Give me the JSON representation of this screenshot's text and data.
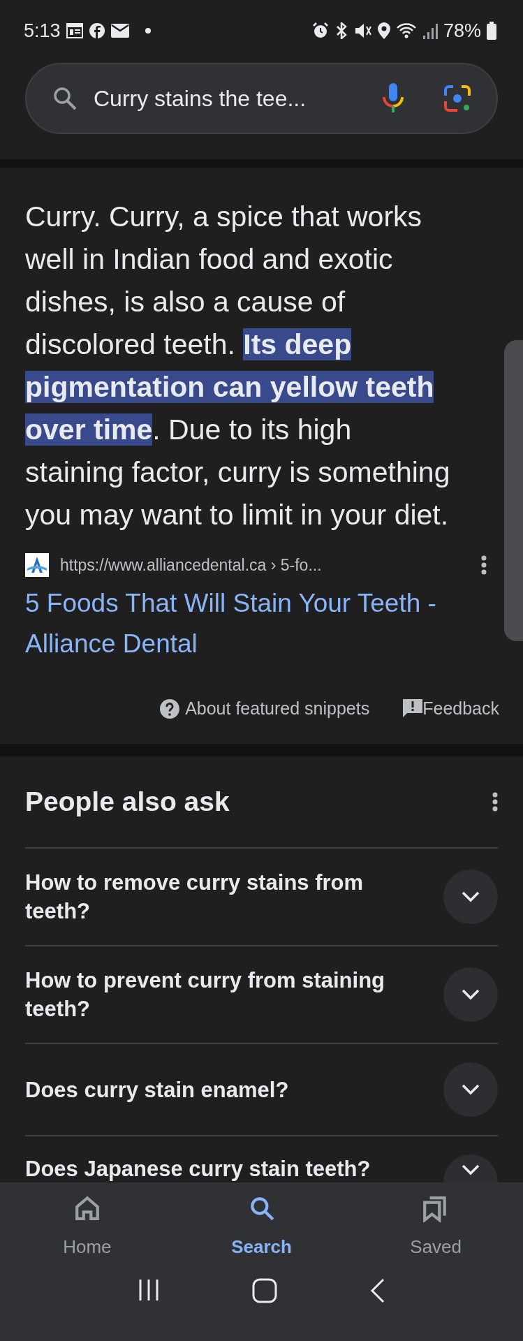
{
  "status_bar": {
    "time": "5:13",
    "battery": "78%"
  },
  "search": {
    "value": "Curry stains the tee..."
  },
  "snippet": {
    "segments": [
      {
        "text": "Curry. Curry, a spice that works well in Indian food and exotic dishes, is also a cause of discolored teeth. ",
        "highlighted": false
      },
      {
        "text": "Its deep pigmentation can yellow teeth over time",
        "highlighted": true
      },
      {
        "text": ". Due to its high staining factor, curry is something you may want to limit in your diet.",
        "highlighted": false
      }
    ],
    "source_url": "https://www.alliancedental.ca",
    "source_path": "› 5-fo...",
    "title": "5 Foods That Will Stain Your Teeth - Alliance Dental",
    "about": "About featured snippets",
    "feedback": "Feedback"
  },
  "people_also_ask": {
    "title": "People also ask",
    "questions": [
      {
        "text": "How to remove curry stains from teeth?",
        "expanded": false
      },
      {
        "text": "How to prevent curry from staining teeth?",
        "expanded": false
      },
      {
        "text": "Does curry stain enamel?",
        "expanded": false
      },
      {
        "text": "Does Japanese curry stain teeth?",
        "expanded": false
      }
    ]
  },
  "bottom_nav": [
    {
      "label": "Home",
      "selected": false
    },
    {
      "label": "Search",
      "selected": true
    },
    {
      "label": "Saved",
      "selected": false
    }
  ]
}
